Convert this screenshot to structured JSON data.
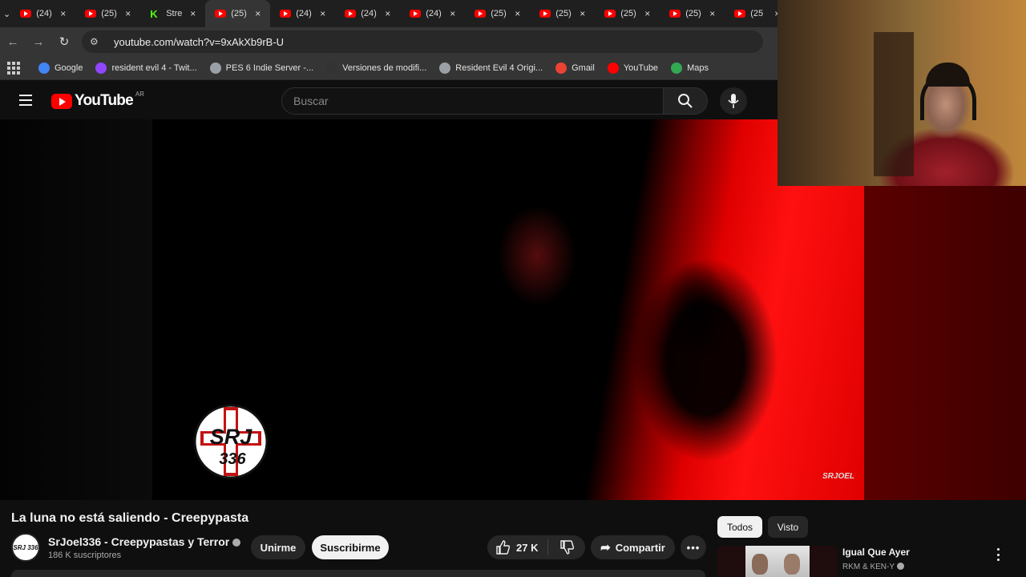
{
  "browser": {
    "tabs": [
      {
        "title": "(24)",
        "icon": "youtube-icon",
        "active": false
      },
      {
        "title": "(25)",
        "icon": "youtube-icon",
        "active": false
      },
      {
        "title": "Stre",
        "icon": "kick-icon",
        "active": false
      },
      {
        "title": "(25)",
        "icon": "youtube-icon",
        "active": true
      },
      {
        "title": "(24)",
        "icon": "youtube-icon",
        "active": false
      },
      {
        "title": "(24)",
        "icon": "youtube-icon",
        "active": false
      },
      {
        "title": "(24)",
        "icon": "youtube-icon",
        "active": false
      },
      {
        "title": "(25)",
        "icon": "youtube-icon",
        "active": false
      },
      {
        "title": "(25)",
        "icon": "youtube-icon",
        "active": false
      },
      {
        "title": "(25)",
        "icon": "youtube-icon",
        "active": false
      },
      {
        "title": "(25)",
        "icon": "youtube-icon",
        "active": false
      },
      {
        "title": "(25",
        "icon": "youtube-icon",
        "active": false
      }
    ],
    "close_glyph": "×",
    "url": "youtube.com/watch?v=9xAkXb9rB-U",
    "bookmarks": [
      {
        "label": "Google",
        "icon": "google-icon",
        "color": "#4285f4"
      },
      {
        "label": "resident evil 4 - Twit...",
        "icon": "twitch-icon",
        "color": "#9146ff"
      },
      {
        "label": "PES 6 Indie Server -...",
        "icon": "globe-icon",
        "color": "#9aa0a6"
      },
      {
        "label": "Versiones de modifi...",
        "icon": "site-icon",
        "color": "#333333"
      },
      {
        "label": "Resident Evil 4 Origi...",
        "icon": "globe-icon",
        "color": "#9aa0a6"
      },
      {
        "label": "Gmail",
        "icon": "gmail-icon",
        "color": "#ea4335"
      },
      {
        "label": "YouTube",
        "icon": "youtube-icon",
        "color": "#ff0000"
      },
      {
        "label": "Maps",
        "icon": "maps-icon",
        "color": "#34a853"
      }
    ]
  },
  "youtube": {
    "logo_text": "YouTube",
    "country_code": "AR",
    "search_placeholder": "Buscar",
    "video": {
      "watermark": "SRJOEL",
      "overlay_logo_top": "SRJ",
      "overlay_logo_bottom": "336",
      "title": "La luna no está saliendo - Creepypasta",
      "channel_name": "SrJoel336 - Creepypastas y Terror",
      "channel_avatar_text": "SRJ 336",
      "subscribers": "186 K suscriptores",
      "join_label": "Unirme",
      "subscribe_label": "Suscribirme",
      "likes": "27 K",
      "share_label": "Compartir",
      "more_label": "•••"
    },
    "filters": [
      "Todos",
      "Visto"
    ],
    "recommendation": {
      "title": "Igual Que Ayer",
      "channel": "RKM & KEN-Y"
    }
  },
  "colors": {
    "accent": "#ff0000",
    "background": "#0f0f0f",
    "chip_bg": "#272727"
  }
}
